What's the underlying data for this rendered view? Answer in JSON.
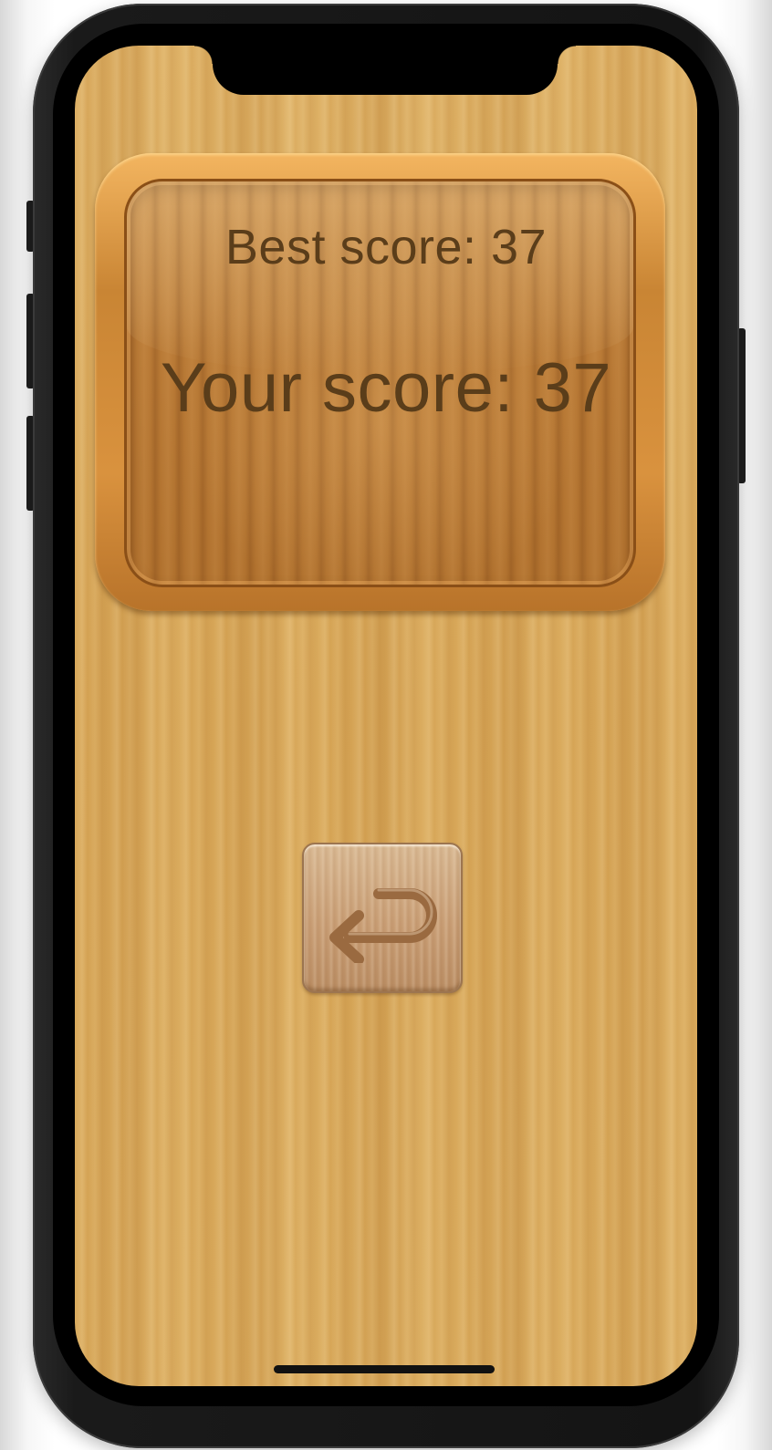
{
  "device": {
    "model_frame": "phone-frame"
  },
  "scoreboard": {
    "best_score_label": "Best score: 37",
    "your_score_label": "Your score: 37"
  },
  "controls": {
    "back_icon": "return-arrow-icon"
  },
  "colors": {
    "text": "#5a3d1a",
    "wood_background": "#d9aa5c",
    "board_frame": "#c98534",
    "button_face": "#caa17a"
  }
}
